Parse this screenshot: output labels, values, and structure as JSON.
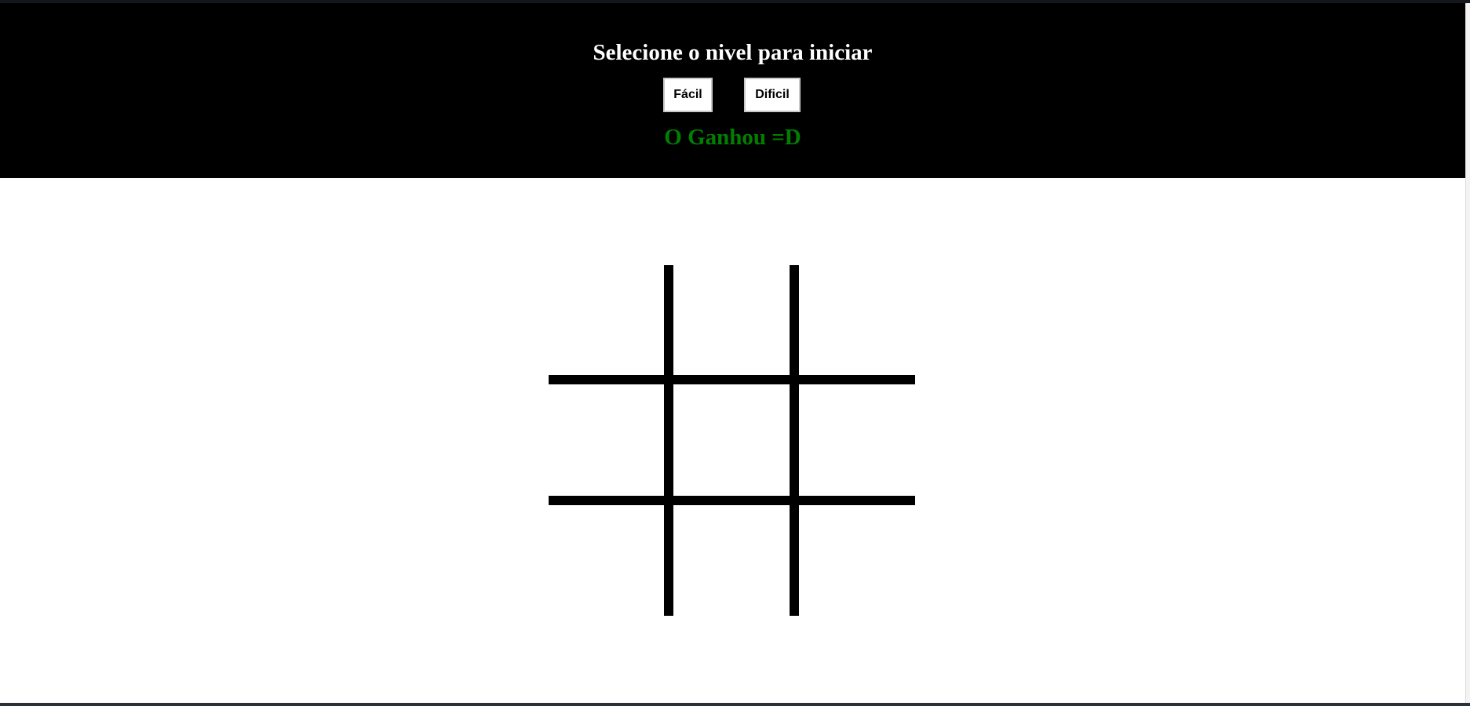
{
  "header": {
    "title": "Selecione o nivel para iniciar",
    "buttons": {
      "easy": "Fácil",
      "hard": "Dificil"
    },
    "status": "O Ganhou =D"
  },
  "colors": {
    "header_bg": "#000000",
    "title": "#ffffff",
    "status": "#008000",
    "board_lines": "#000000",
    "page_bg": "#ffffff"
  },
  "board": {
    "rows": 3,
    "cols": 3,
    "cells": [
      "",
      "",
      "",
      "",
      "",
      "",
      "",
      "",
      ""
    ]
  }
}
